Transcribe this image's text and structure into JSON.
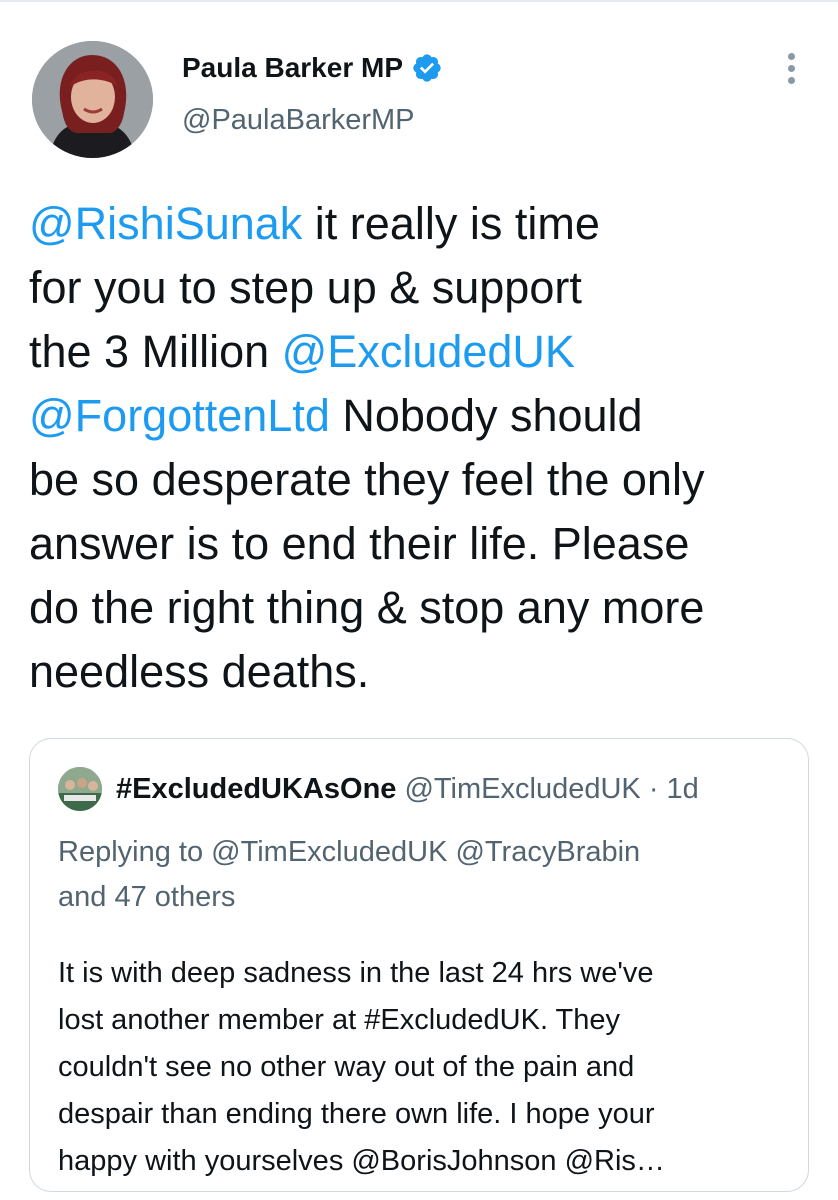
{
  "tweet": {
    "author": {
      "name": "Paula Barker MP",
      "handle": "@PaulaBarkerMP",
      "verified": true,
      "avatar_icon": "profile-photo"
    },
    "text_lines": [
      [
        {
          "t": "@RishiSunak",
          "m": true
        },
        {
          "t": " it really is time",
          "m": false
        }
      ],
      [
        {
          "t": "for you to step up & support",
          "m": false
        }
      ],
      [
        {
          "t": "the 3 Million ",
          "m": false
        },
        {
          "t": "@ExcludedUK",
          "m": true
        }
      ],
      [
        {
          "t": "@ForgottenLtd",
          "m": true
        },
        {
          "t": " Nobody should",
          "m": false
        }
      ],
      [
        {
          "t": "be so desperate they feel the only",
          "m": false
        }
      ],
      [
        {
          "t": "answer is to end their life. Please",
          "m": false
        }
      ],
      [
        {
          "t": "do the right thing & stop any more",
          "m": false
        }
      ],
      [
        {
          "t": "needless deaths.",
          "m": false
        }
      ]
    ]
  },
  "quoted": {
    "name": "#ExcludedUKAsOne",
    "handle": "@TimExcludedUK",
    "separator": "·",
    "time": "1d",
    "replying_prefix": "Replying to",
    "replying_to": [
      "@TimExcludedUK",
      "@TracyBrabin"
    ],
    "replying_others": "and 47 others",
    "body_lines": [
      "It is with deep sadness in the last 24 hrs we've",
      "lost another member at #ExcludedUK. They",
      "couldn't see no other way out of the pain and",
      "despair than ending there own life. I hope your",
      "happy with yourselves @BorisJohnson @Ris…"
    ]
  },
  "icons": {
    "verified": "verified-badge-icon",
    "more": "more-vertical-icon"
  },
  "colors": {
    "link": "#1d9bf0",
    "text": "#0f1419",
    "secondary": "#536471",
    "border": "#cfd9de"
  }
}
